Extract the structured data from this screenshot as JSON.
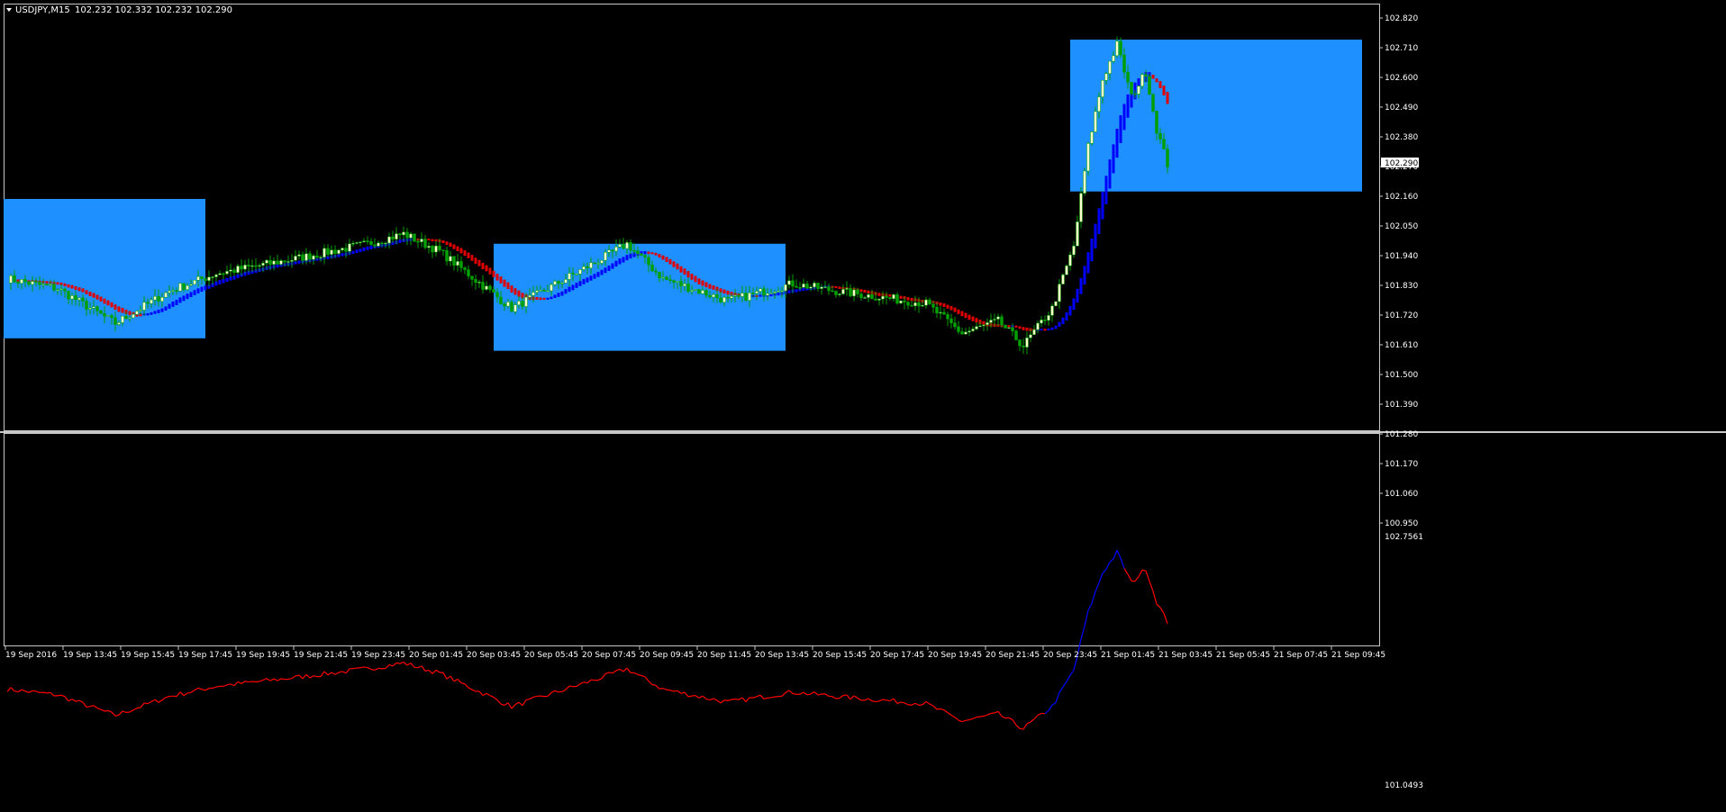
{
  "header": {
    "symbol_label": "USDJPY,M15",
    "ohlc": "102.232 102.332 102.232 102.290"
  },
  "price_axis": {
    "labels": [
      "102.820",
      "102.710",
      "102.600",
      "102.490",
      "102.380",
      "102.270",
      "102.160",
      "102.050",
      "101.940",
      "101.830",
      "101.720",
      "101.610",
      "101.500",
      "101.390",
      "101.280",
      "101.170",
      "101.060",
      "100.950"
    ],
    "current_price": "102.290"
  },
  "indicator_axis": {
    "top": "102.7561",
    "bottom": "101.0493"
  },
  "time_axis": {
    "labels": [
      "19 Sep 2016",
      "19 Sep 13:45",
      "19 Sep 15:45",
      "19 Sep 17:45",
      "19 Sep 19:45",
      "19 Sep 21:45",
      "19 Sep 23:45",
      "20 Sep 01:45",
      "20 Sep 03:45",
      "20 Sep 05:45",
      "20 Sep 07:45",
      "20 Sep 09:45",
      "20 Sep 11:45",
      "20 Sep 13:45",
      "20 Sep 15:45",
      "20 Sep 17:45",
      "20 Sep 19:45",
      "20 Sep 21:45",
      "20 Sep 23:45",
      "21 Sep 01:45",
      "21 Sep 03:45",
      "21 Sep 05:45",
      "21 Sep 07:45",
      "21 Sep 09:45"
    ]
  },
  "colors": {
    "background": "#000000",
    "zone_box": "#1e90ff",
    "bull_candle": "#ffffcc",
    "bear_candle": "#00a000",
    "ma_bear": "#e00000",
    "ma_bull": "#0000ff",
    "indicator_bear": "#ff0000",
    "indicator_bull": "#0000ff"
  },
  "chart_data": {
    "type": "candlestick",
    "symbol": "USDJPY",
    "timeframe": "M15",
    "ylim": [
      100.95,
      102.82
    ],
    "anchors": [
      [
        0,
        101.82
      ],
      [
        14,
        101.78
      ],
      [
        30,
        101.64
      ],
      [
        45,
        101.77
      ],
      [
        58,
        101.84
      ],
      [
        80,
        101.9
      ],
      [
        100,
        101.96
      ],
      [
        110,
        102.0
      ],
      [
        120,
        101.93
      ],
      [
        140,
        101.7
      ],
      [
        150,
        101.78
      ],
      [
        165,
        101.9
      ],
      [
        172,
        101.96
      ],
      [
        182,
        101.82
      ],
      [
        200,
        101.73
      ],
      [
        218,
        101.8
      ],
      [
        230,
        101.77
      ],
      [
        245,
        101.74
      ],
      [
        255,
        101.72
      ],
      [
        265,
        101.6
      ],
      [
        275,
        101.65
      ],
      [
        282,
        101.55
      ],
      [
        290,
        101.7
      ],
      [
        296,
        101.95
      ],
      [
        300,
        102.35
      ],
      [
        304,
        102.62
      ],
      [
        308,
        102.76
      ],
      [
        312,
        102.55
      ],
      [
        316,
        102.65
      ],
      [
        319,
        102.42
      ],
      [
        322,
        102.28
      ]
    ],
    "zones": [
      {
        "start_bar": 0,
        "end_bar": 55,
        "high": 102.14,
        "low": 101.58
      },
      {
        "start_bar": 136,
        "end_bar": 216,
        "high": 101.96,
        "low": 101.53
      },
      {
        "start_bar": 296,
        "end_bar": 376,
        "high": 102.78,
        "low": 102.17
      }
    ],
    "indicator_range": [
      101.0493,
      102.7561
    ]
  }
}
